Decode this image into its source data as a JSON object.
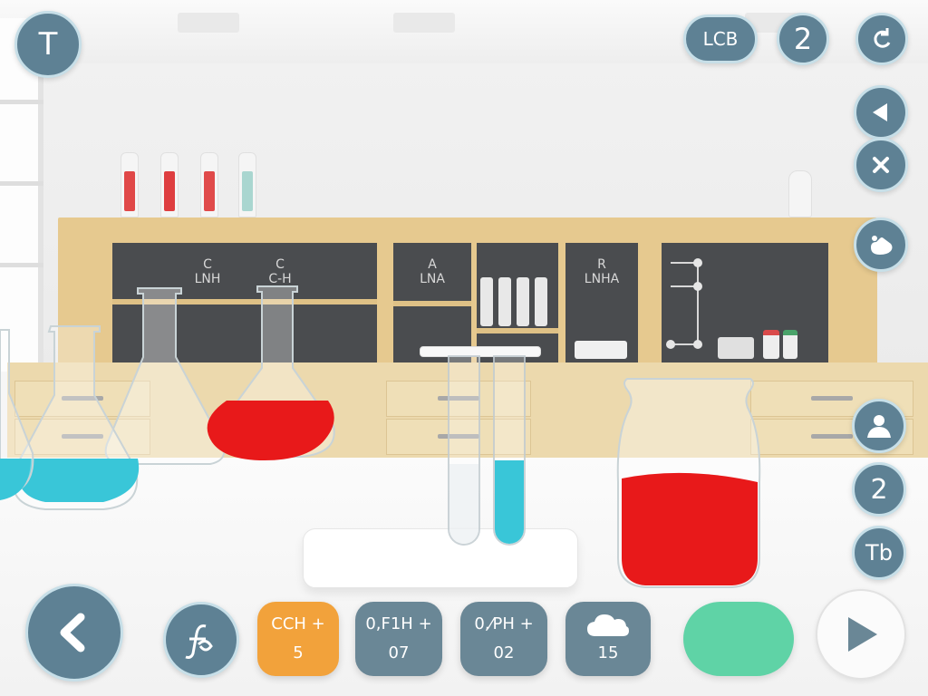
{
  "hud": {
    "top_left_button": "T",
    "level_badge": "LCB",
    "counter_badge": "2",
    "right_count_badge": "2",
    "table_button": "Tb",
    "profile_label": "P ♂"
  },
  "wall": {
    "board_labels": [
      "C\nLNH",
      "C\nC-H",
      "A\nLNA",
      "R\nLNHA"
    ]
  },
  "toolbar": {
    "cards": [
      {
        "line1": "CCH +",
        "line2": "5",
        "color": "#f2a23b"
      },
      {
        "line1": "0,F1H +",
        "line2": "07",
        "color": "#6a8796"
      },
      {
        "line1": "0,⁄PH +",
        "line2": "02",
        "color": "#6a8796"
      },
      {
        "line1": "",
        "line2": "15",
        "color": "#6a8796",
        "icon": "cloud-icon"
      }
    ],
    "confirm_color": "#5fd3a6"
  },
  "colors": {
    "hud": "#5e8194",
    "hud_border": "#c7dfe8",
    "red_liquid": "#e8191a",
    "blue_liquid": "#39c6d8",
    "accent_orange": "#f2a23b",
    "accent_green": "#5fd3a6"
  }
}
